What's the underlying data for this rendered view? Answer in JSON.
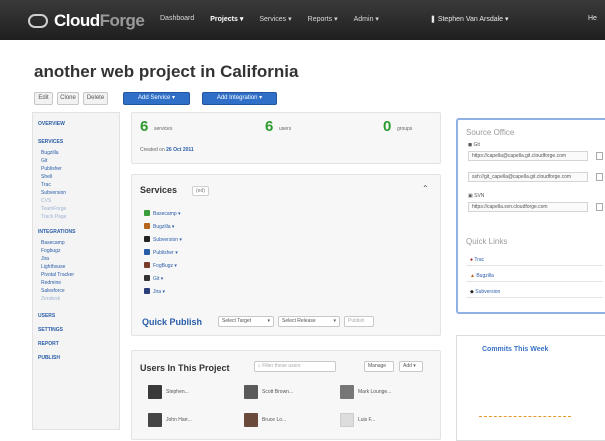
{
  "app": {
    "logo_part1": "Cloud",
    "logo_part2": "Forge",
    "nav": [
      "Dashboard",
      "Projects ▾",
      "Services ▾",
      "Reports ▾",
      "Admin ▾"
    ],
    "active_nav_index": 1,
    "user": "Stephen Van Arsdale ▾",
    "help_label": "He"
  },
  "page": {
    "title": "another web project in California",
    "buttons": {
      "edit": "Edit",
      "clone": "Clone",
      "delete": "Delete",
      "add_service": "Add Service ▾",
      "add_integration": "Add Integration ▾"
    }
  },
  "sidebar": {
    "sections": [
      {
        "label": "OVERVIEW",
        "items": []
      },
      {
        "label": "SERVICES",
        "items": [
          "Bugzilla",
          "Git",
          "Publisher",
          "Shell",
          "Trac",
          "Subversion",
          "CVS",
          "TeamForge",
          "Track Page"
        ]
      },
      {
        "label": "INTEGRATIONS",
        "items": [
          "Basecamp",
          "Fogbugz",
          "Jira",
          "Lighthouse",
          "Pivotal Tracker",
          "Redmine",
          "Salesforce",
          "Zendesk"
        ]
      },
      {
        "label": "USERS",
        "items": []
      },
      {
        "label": "SETTINGS",
        "items": []
      },
      {
        "label": "REPORT",
        "items": []
      },
      {
        "label": "PUBLISH",
        "items": []
      }
    ],
    "dim_items": [
      "CVS",
      "TeamForge",
      "Track Page",
      "Zendesk"
    ]
  },
  "stats": {
    "services_count": "6",
    "services_label": "services",
    "users_count": "6",
    "users_label": "users",
    "groups_count": "0",
    "groups_label": "groups",
    "created_prefix": "Created on",
    "created_date": "26 Oct 2011"
  },
  "services": {
    "title": "Services",
    "badge": "(ed)",
    "items": [
      {
        "label": "Basecamp ▾",
        "color": "#3b9c3b"
      },
      {
        "label": "Bugzilla ▾",
        "color": "#b5651d"
      },
      {
        "label": "Subversion ▾",
        "color": "#222222"
      },
      {
        "label": "Publisher ▾",
        "color": "#2a5da8"
      },
      {
        "label": "FogBugz ▾",
        "color": "#7a3c2a"
      },
      {
        "label": "Git ▾",
        "color": "#333333"
      },
      {
        "label": "Jira ▾",
        "color": "#2a3f7a"
      }
    ],
    "quick_publish_label": "Quick Publish",
    "select_target": "Select Target",
    "select_release": "Select Release",
    "publish_button": "Publish"
  },
  "users": {
    "title": "Users In This Project",
    "search_placeholder": "Filter these users",
    "manage_label": "Manage",
    "add_label": "Add ▾",
    "members": [
      {
        "name": "Stephen...",
        "color": "#3a3a3a"
      },
      {
        "name": "Scott Brown...",
        "color": "#5a5a5a"
      },
      {
        "name": "Mark Lounge...",
        "color": "#777777"
      },
      {
        "name": "John Harr...",
        "color": "#444444"
      },
      {
        "name": "Bruce Lo...",
        "color": "#6a4a3a"
      },
      {
        "name": "Luis F...",
        "color": "#dddddd"
      }
    ]
  },
  "source_access": {
    "title": "Source Office",
    "items": [
      {
        "label": "Git",
        "url": "https://capella@capella.git.cloudforge.com"
      },
      {
        "label": "",
        "url": "ssh://git_capella@capella.git.cloudforge.com"
      },
      {
        "label": "SVN",
        "url": "https://capella.svn.cloudforge.com"
      }
    ],
    "quick_links_title": "Quick Links",
    "quick_links": [
      {
        "label": "Trac",
        "color": "#a01818"
      },
      {
        "label": "Bugzilla",
        "color": "#b5651d"
      },
      {
        "label": "Subversion",
        "color": "#222222"
      }
    ]
  },
  "commits": {
    "title": "Commits This Week"
  }
}
